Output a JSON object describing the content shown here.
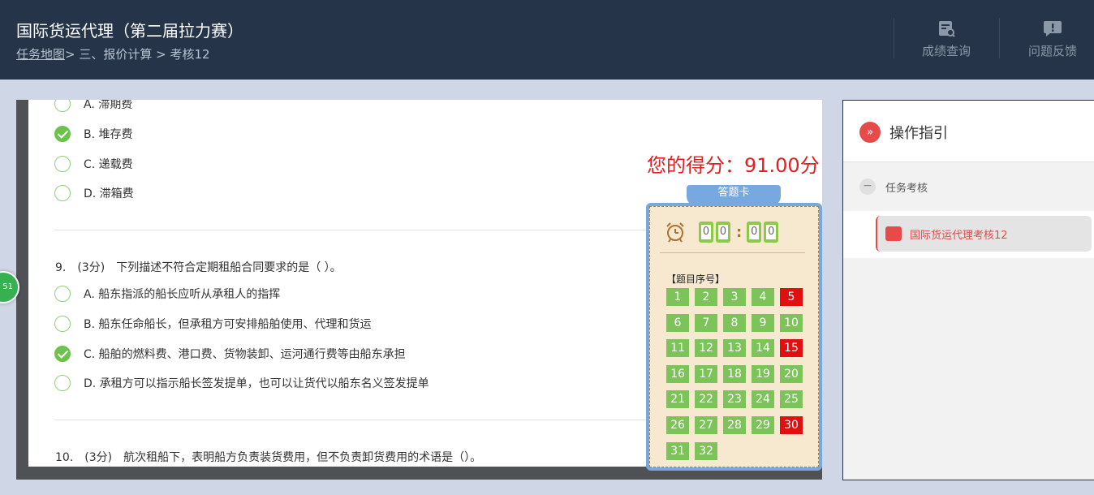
{
  "header": {
    "title": "国际货运代理（第二届拉力赛）",
    "breadcrumb_link": "任务地图",
    "breadcrumb_rest": "> 三、报价计算 > 考核12",
    "buttons": [
      {
        "label": "成绩查询",
        "icon": "score-query-icon"
      },
      {
        "label": "问题反馈",
        "icon": "feedback-icon"
      }
    ]
  },
  "questions": {
    "q8_options": [
      {
        "text": "A.  滞期费",
        "checked": false
      },
      {
        "text": "B.  堆存费",
        "checked": true
      },
      {
        "text": "C.  递载费",
        "checked": false
      },
      {
        "text": "D.  滞箱费",
        "checked": false
      }
    ],
    "q9": {
      "num": "9.",
      "score": "(3分)",
      "text": "下列描述不符合定期租船合同要求的是（ ）。",
      "options": [
        {
          "text": "A.  船东指派的船长应听从承租人的指挥",
          "checked": false
        },
        {
          "text": "B.  船东任命船长，但承租方可安排船舶使用、代理和货运",
          "checked": false
        },
        {
          "text": "C.  船舶的燃料费、港口费、货物装卸、运河通行费等由船东承担",
          "checked": true
        },
        {
          "text": "D.  承租方可以指示船长签发提单，也可以让货代以船东名义签发提单",
          "checked": false
        }
      ]
    },
    "q10": {
      "num": "10.",
      "score": "(3分)",
      "text": "航次租船下，表明船方负责装货费用，但不负责卸货费用的术语是（）。"
    }
  },
  "score_text": "您的得分：91.00分",
  "answer_card": {
    "ribbon": "答题卡",
    "timer": [
      "0",
      "0",
      "0",
      "0"
    ],
    "timer_colon": ":",
    "seq_title": "【题目序号】",
    "items": [
      {
        "n": "1",
        "wrong": false
      },
      {
        "n": "2",
        "wrong": false
      },
      {
        "n": "3",
        "wrong": false
      },
      {
        "n": "4",
        "wrong": false
      },
      {
        "n": "5",
        "wrong": true
      },
      {
        "n": "6",
        "wrong": false
      },
      {
        "n": "7",
        "wrong": false
      },
      {
        "n": "8",
        "wrong": false
      },
      {
        "n": "9",
        "wrong": false
      },
      {
        "n": "10",
        "wrong": false
      },
      {
        "n": "11",
        "wrong": false
      },
      {
        "n": "12",
        "wrong": false
      },
      {
        "n": "13",
        "wrong": false
      },
      {
        "n": "14",
        "wrong": false
      },
      {
        "n": "15",
        "wrong": true
      },
      {
        "n": "16",
        "wrong": false
      },
      {
        "n": "17",
        "wrong": false
      },
      {
        "n": "18",
        "wrong": false
      },
      {
        "n": "19",
        "wrong": false
      },
      {
        "n": "20",
        "wrong": false
      },
      {
        "n": "21",
        "wrong": false
      },
      {
        "n": "22",
        "wrong": false
      },
      {
        "n": "23",
        "wrong": false
      },
      {
        "n": "24",
        "wrong": false
      },
      {
        "n": "25",
        "wrong": false
      },
      {
        "n": "26",
        "wrong": false
      },
      {
        "n": "27",
        "wrong": false
      },
      {
        "n": "28",
        "wrong": false
      },
      {
        "n": "29",
        "wrong": false
      },
      {
        "n": "30",
        "wrong": true
      },
      {
        "n": "31",
        "wrong": false
      },
      {
        "n": "32",
        "wrong": false
      }
    ]
  },
  "side_badge": "51",
  "panel": {
    "title": "操作指引",
    "section": "任务考核",
    "section_toggle": "−",
    "task": "国际货运代理考核12"
  },
  "colors": {
    "header_bg": "#253448",
    "correct_green": "#7cc35a",
    "wrong_red": "#e01010",
    "score_red": "#e02020",
    "accent_red": "#e34a4a"
  }
}
